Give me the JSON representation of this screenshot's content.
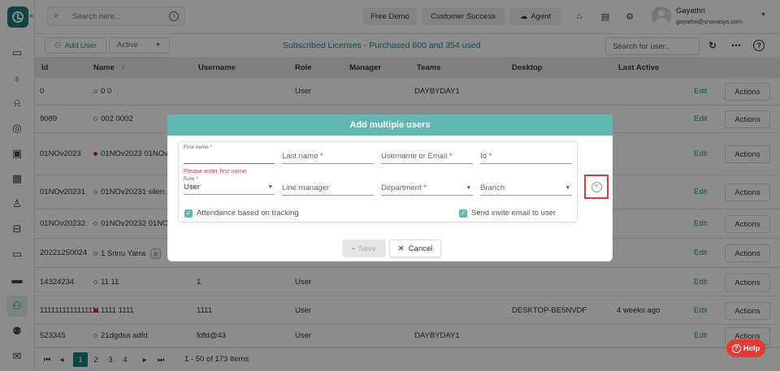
{
  "topbar": {
    "search_placeholder": "Search here...",
    "free_demo": "Free Demo",
    "customer_success": "Customer Success",
    "agent": "Agent",
    "user_name": "Gayathri",
    "user_email": "gayathri@snovasys.com"
  },
  "toolbar": {
    "add_user": "Add User",
    "status_filter": "Active",
    "license_title": "Subscribed Licenses - Purchased 600 and 354 used",
    "user_search_placeholder": "Search for user.."
  },
  "table": {
    "headers": [
      "Id",
      "Name",
      "Username",
      "Role",
      "Manager",
      "Teams",
      "Desktop",
      "Last Active"
    ],
    "sort_indicator": "↑",
    "edit_label": "Edit",
    "actions_label": "Actions",
    "rows": [
      {
        "id": "0",
        "name": "0 0",
        "username": "",
        "role": "User",
        "teams": "DAYBYDAY1",
        "desktop": "",
        "last_active": "",
        "dot": "grey"
      },
      {
        "id": "9089",
        "name": "002 0002",
        "username": "",
        "role": "",
        "teams": "",
        "desktop": "",
        "last_active": "",
        "dot": "grey"
      },
      {
        "id": "01NOv2023",
        "name": "01NOv2023 01NOv2...",
        "username": "",
        "role": "",
        "teams": "",
        "desktop": "",
        "last_active": "",
        "dot": "red"
      },
      {
        "id": "01NOv20231",
        "name": "01NOv20231 silen...",
        "username": "",
        "role": "",
        "teams": "",
        "desktop": "",
        "last_active": "",
        "dot": "grey"
      },
      {
        "id": "01NOv20232",
        "name": "01NOv20232 01NOv...",
        "username": "",
        "role": "",
        "teams": "",
        "desktop": "",
        "last_active": "",
        "dot": "grey"
      },
      {
        "id": "20221250024",
        "name": "1 Srinu Yarra",
        "username": "",
        "role": "",
        "teams": "",
        "desktop": "",
        "last_active": "",
        "dot": "grey",
        "badge": "a"
      },
      {
        "id": "14324234",
        "name": "11 11",
        "username": "1",
        "role": "User",
        "teams": "",
        "desktop": "",
        "last_active": "",
        "dot": "grey"
      },
      {
        "id": "1111111111111111",
        "name": "1111 1111",
        "username": "1111",
        "role": "User",
        "teams": "",
        "desktop": "DESKTOP-BE5NVDF",
        "last_active": "4 weeks ago",
        "dot": "red"
      },
      {
        "id": "523345",
        "name": "21dgdsa adfd",
        "username": "fdfd@43",
        "role": "User",
        "teams": "DAYBYDAY1",
        "desktop": "",
        "last_active": "",
        "dot": "grey"
      }
    ]
  },
  "pagination": {
    "pages": [
      "1",
      "2",
      "3",
      "4"
    ],
    "current": "1",
    "info": "1 - 50 of 173 Items"
  },
  "help": {
    "label": "Help"
  },
  "modal": {
    "title": "Add multiple users",
    "first_name_label": "First name",
    "first_name_error": "Please enter first name",
    "last_name": "Last name",
    "username_email": "Username or Email",
    "id": "Id",
    "role_label": "Role",
    "role_value": "User",
    "line_manager": "Line manager",
    "department": "Department",
    "branch": "Branch",
    "attendance": "Attendance based on tracking",
    "send_invite": "Send invite email to user",
    "required_mark": "*",
    "save": "Save",
    "cancel": "Cancel"
  }
}
